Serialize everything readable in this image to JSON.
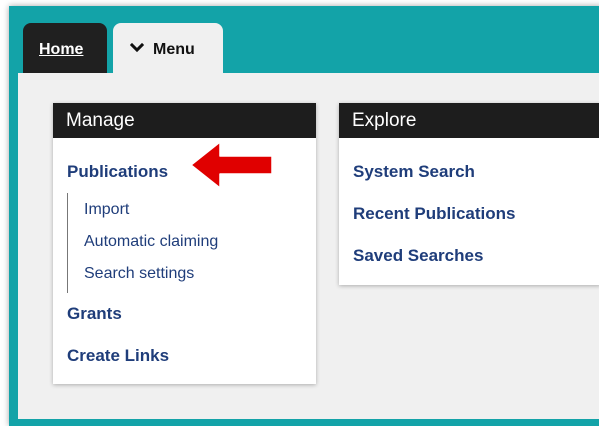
{
  "tabs": {
    "home_label": "Home",
    "menu_label": "Menu"
  },
  "manage": {
    "title": "Manage",
    "publications": "Publications",
    "sub_items": [
      "Import",
      "Automatic claiming",
      "Search settings"
    ],
    "grants": "Grants",
    "create_links": "Create Links"
  },
  "explore": {
    "title": "Explore",
    "items": [
      "System Search",
      "Recent Publications",
      "Saved Searches"
    ]
  },
  "icons": {
    "menu_toggle": "chevron-down-icon",
    "annotation": "red-arrow-left-icon"
  },
  "colors": {
    "frame_teal": "#13a3a8",
    "header_dark": "#1d1d1d",
    "link_blue": "#1f3d7a",
    "arrow_red": "#e00000"
  }
}
